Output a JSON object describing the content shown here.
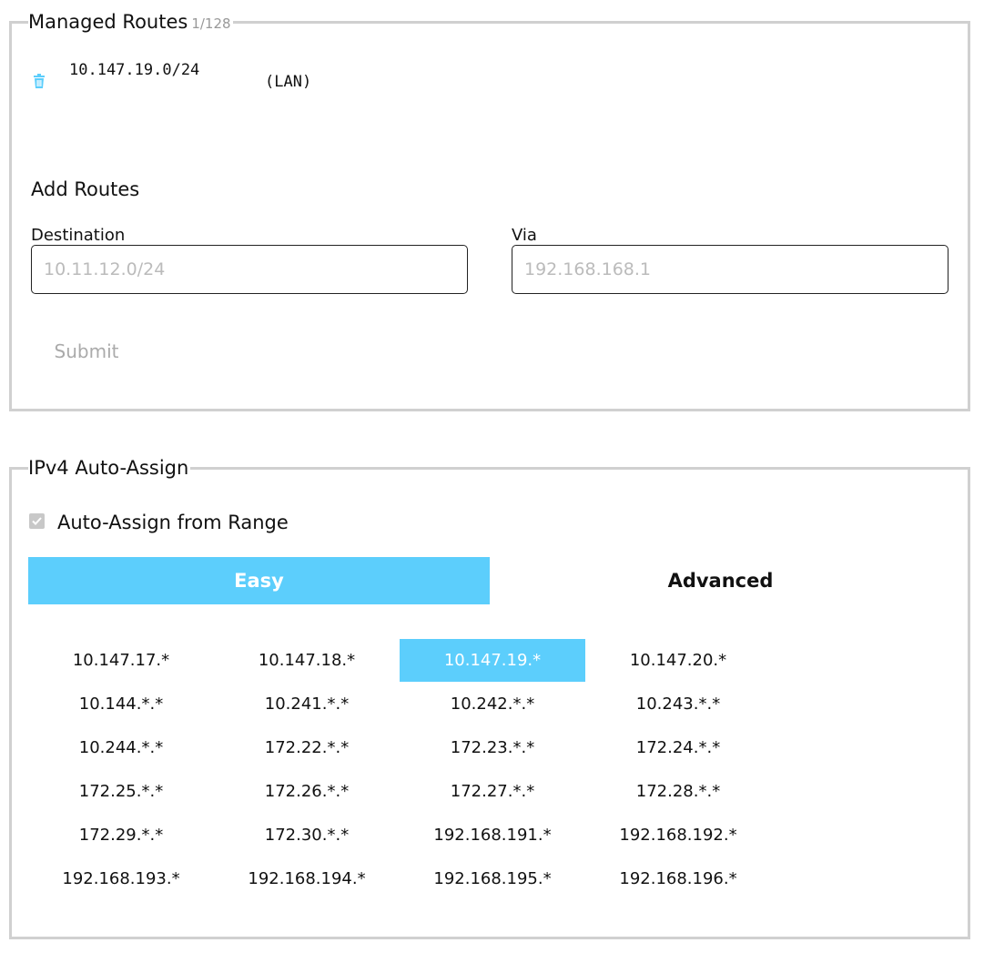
{
  "managed_routes": {
    "title": "Managed Routes",
    "count": "1/128",
    "routes": [
      {
        "destination": "10.147.19.0/24",
        "via": "(LAN)"
      }
    ]
  },
  "add_routes": {
    "title": "Add Routes",
    "destination_label": "Destination",
    "destination_placeholder": "10.11.12.0/24",
    "via_label": "Via",
    "via_placeholder": "192.168.168.1",
    "submit_label": "Submit"
  },
  "ipv4": {
    "title": "IPv4 Auto-Assign",
    "auto_assign_label": "Auto-Assign from Range",
    "auto_assign_checked": true,
    "tabs": [
      {
        "label": "Easy",
        "active": true
      },
      {
        "label": "Advanced",
        "active": false
      }
    ],
    "ranges": [
      "10.147.17.*",
      "10.147.18.*",
      "10.147.19.*",
      "10.147.20.*",
      "10.144.*.*",
      "10.241.*.*",
      "10.242.*.*",
      "10.243.*.*",
      "10.244.*.*",
      "172.22.*.*",
      "172.23.*.*",
      "172.24.*.*",
      "172.25.*.*",
      "172.26.*.*",
      "172.27.*.*",
      "172.28.*.*",
      "172.29.*.*",
      "172.30.*.*",
      "192.168.191.*",
      "192.168.192.*",
      "192.168.193.*",
      "192.168.194.*",
      "192.168.195.*",
      "192.168.196.*"
    ],
    "selected_range": "10.147.19.*"
  },
  "colors": {
    "accent": "#5ccefc",
    "border": "#d0d0d0",
    "muted_text": "#aaaaaa"
  },
  "icons": {
    "delete_route": "trash-icon",
    "checkbox": "checkmark-icon"
  }
}
